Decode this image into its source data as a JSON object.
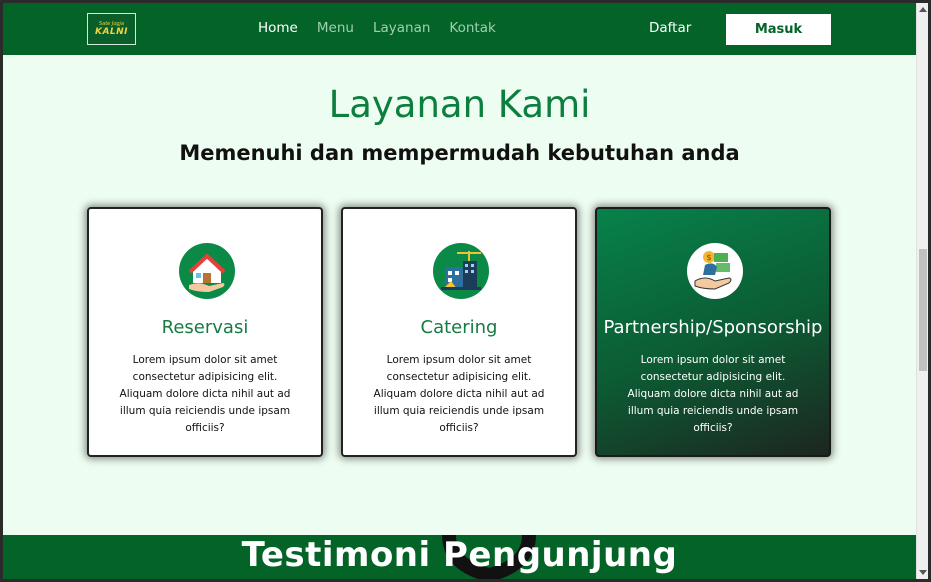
{
  "navbar": {
    "logo_line1": "Sate Jogja",
    "logo_line2": "KALNI",
    "links": [
      "Home",
      "Menu",
      "Layanan",
      "Kontak"
    ],
    "active_link": "Home",
    "register_label": "Daftar",
    "login_label": "Masuk"
  },
  "section": {
    "title": "Layanan Kami",
    "subtitle": "Memenuhi dan mempermudah kebutuhan anda"
  },
  "cards": [
    {
      "title": "Reservasi",
      "icon": "house-hand-icon",
      "description": "Lorem ipsum dolor sit amet consectetur adipisicing elit. Aliquam dolore dicta nihil aut ad illum quia reiciendis unde ipsam officiis?"
    },
    {
      "title": "Catering",
      "icon": "buildings-crane-icon",
      "description": "Lorem ipsum dolor sit amet consectetur adipisicing elit. Aliquam dolore dicta nihil aut ad illum quia reiciendis unde ipsam officiis?"
    },
    {
      "title": "Partnership/Sponsorship",
      "icon": "money-hand-icon",
      "description": "Lorem ipsum dolor sit amet consectetur adipisicing elit. Aliquam dolore dicta nihil aut ad illum quia reiciendis unde ipsam officiis?"
    }
  ],
  "testimoni": {
    "title": "Testimoni Pengunjung"
  },
  "colors": {
    "brand_green": "#046428",
    "accent_green": "#0c7f3f",
    "page_bg": "#eefdf1"
  }
}
